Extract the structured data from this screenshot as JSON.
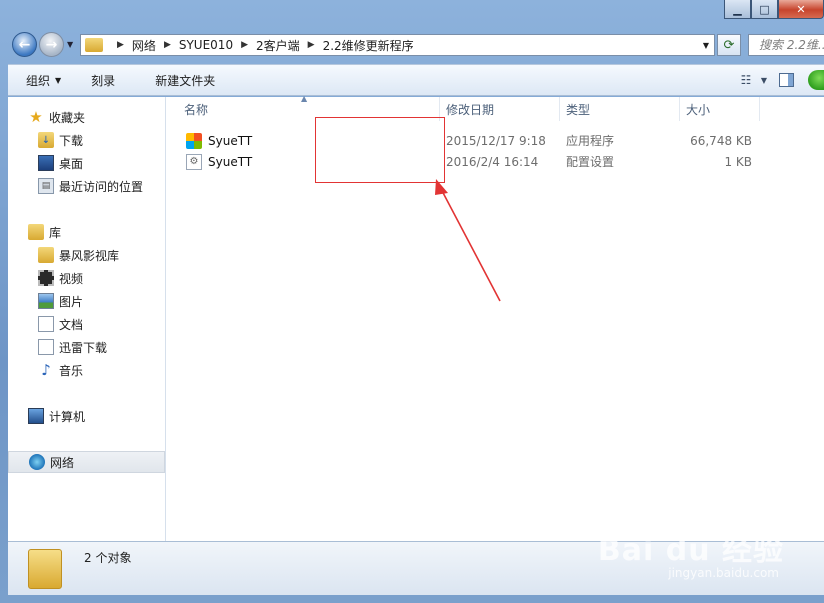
{
  "address": {
    "crumbs": [
      "网络",
      "SYUE010",
      "2客户端",
      "2.2维修更新程序"
    ],
    "search_placeholder": "搜索 2.2维..."
  },
  "toolbar": {
    "organize": "组织",
    "burn": "刻录",
    "new_folder": "新建文件夹"
  },
  "nav": {
    "favorites": "收藏夹",
    "downloads": "下载",
    "desktop": "桌面",
    "recent": "最近访问的位置",
    "libraries": "库",
    "baofeng": "暴风影视库",
    "videos": "视频",
    "pictures": "图片",
    "documents": "文档",
    "xunlei": "迅雷下载",
    "music": "音乐",
    "computer": "计算机",
    "network": "网络"
  },
  "columns": {
    "name": "名称",
    "date": "修改日期",
    "type": "类型",
    "size": "大小"
  },
  "files": [
    {
      "name": "SyueTT",
      "date": "2015/12/17 9:18",
      "type": "应用程序",
      "size": "66,748 KB",
      "icon": "app-icon"
    },
    {
      "name": "SyueTT",
      "date": "2016/2/4 16:14",
      "type": "配置设置",
      "size": "1 KB",
      "icon": "config-icon"
    }
  ],
  "status": {
    "count": "2 个对象"
  },
  "watermark": {
    "main": "Bai du 经验",
    "sub": "jingyan.baidu.com"
  },
  "colors": {
    "highlight_box": "#e23434"
  }
}
